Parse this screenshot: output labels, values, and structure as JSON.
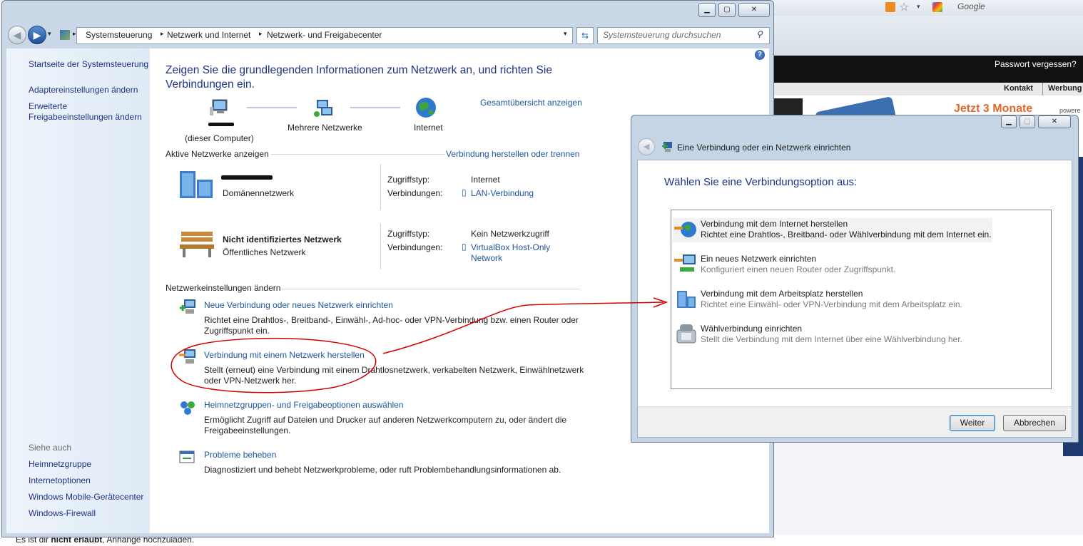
{
  "browser": {
    "search_engine": "Google",
    "passwort_link": "Passwort vergessen?",
    "nav_items": [
      "Kontakt",
      "Werbung"
    ],
    "banner_text": "Jetzt 3 Monate",
    "powered_text": "powere",
    "bottom_text_prefix": "Es ist dir ",
    "bottom_text_bold": "nicht erlaubt",
    "bottom_text_suffix": ", Anhänge hochzuladen."
  },
  "explorer": {
    "breadcrumb": [
      "Systemsteuerung",
      "Netzwerk und Internet",
      "Netzwerk- und Freigabecenter"
    ],
    "search_placeholder": "Systemsteuerung durchsuchen",
    "sidebar": {
      "home": "Startseite der Systemsteuerung",
      "adapter": "Adaptereinstellungen ändern",
      "advanced_line1": "Erweiterte",
      "advanced_line2": "Freigabeeinstellungen ändern",
      "see_also": "Siehe auch",
      "links": [
        "Heimnetzgruppe",
        "Internetoptionen",
        "Windows Mobile-Gerätecenter",
        "Windows-Firewall"
      ]
    },
    "main": {
      "title_line1": "Zeigen Sie die grundlegenden Informationen zum Netzwerk an, und richten Sie",
      "title_line2": "Verbindungen ein.",
      "map_link": "Gesamtübersicht anzeigen",
      "map": {
        "computer_label": "(dieser Computer)",
        "networks_label": "Mehrere Netzwerke",
        "internet_label": "Internet"
      },
      "active_networks_label": "Aktive Netzwerke anzeigen",
      "connect_link": "Verbindung herstellen oder trennen",
      "networks": [
        {
          "type": "Domänennetzwerk",
          "access_label": "Zugriffstyp:",
          "access_value": "Internet",
          "connections_label": "Verbindungen:",
          "connection_value": "LAN-Verbindung"
        },
        {
          "name": "Nicht identifiziertes Netzwerk",
          "type": "Öffentliches Netzwerk",
          "access_label": "Zugriffstyp:",
          "access_value": "Kein Netzwerkzugriff",
          "connections_label": "Verbindungen:",
          "connection_value_line1": "VirtualBox Host-Only",
          "connection_value_line2": "Network"
        }
      ],
      "change_settings_label": "Netzwerkeinstellungen ändern",
      "tasks": [
        {
          "title": "Neue Verbindung oder neues Netzwerk einrichten",
          "desc_line1": "Richtet eine Drahtlos-, Breitband-, Einwähl-, Ad-hoc- oder VPN-Verbindung bzw. einen Router oder",
          "desc_line2": "Zugriffspunkt ein."
        },
        {
          "title": "Verbindung mit einem Netzwerk herstellen",
          "desc_line1": "Stellt (erneut) eine Verbindung mit einem Drahtlosnetzwerk, verkabelten Netzwerk, Einwählnetzwerk",
          "desc_line2": "oder VPN-Netzwerk her."
        },
        {
          "title": "Heimnetzgruppen- und Freigabeoptionen auswählen",
          "desc_line1": "Ermöglicht Zugriff auf Dateien und Drucker auf anderen Netzwerkcomputern zu, oder ändert die",
          "desc_line2": "Freigabeeinstellungen."
        },
        {
          "title": "Probleme beheben",
          "desc_line1": "Diagnostiziert und behebt Netzwerkprobleme, oder ruft Problembehandlungsinformationen ab.",
          "desc_line2": ""
        }
      ]
    }
  },
  "dialog": {
    "title": "Eine Verbindung oder ein Netzwerk einrichten",
    "heading": "Wählen Sie eine Verbindungsoption aus:",
    "options": [
      {
        "title": "Verbindung mit dem Internet herstellen",
        "desc": "Richtet eine Drahtlos-, Breitband- oder Wählverbindung mit dem Internet ein."
      },
      {
        "title": "Ein neues Netzwerk einrichten",
        "desc": "Konfiguriert einen neuen Router oder Zugriffspunkt."
      },
      {
        "title": "Verbindung mit dem Arbeitsplatz herstellen",
        "desc": "Richtet eine Einwähl- oder VPN-Verbindung mit dem Arbeitsplatz ein."
      },
      {
        "title": "Wählverbindung einrichten",
        "desc": "Stellt die Verbindung mit dem Internet über eine Wählverbindung her."
      }
    ],
    "next_button": "Weiter",
    "cancel_button": "Abbrechen"
  },
  "colors": {
    "link": "#1e56a0",
    "heading": "#1e3287",
    "annotation": "#d40000"
  }
}
